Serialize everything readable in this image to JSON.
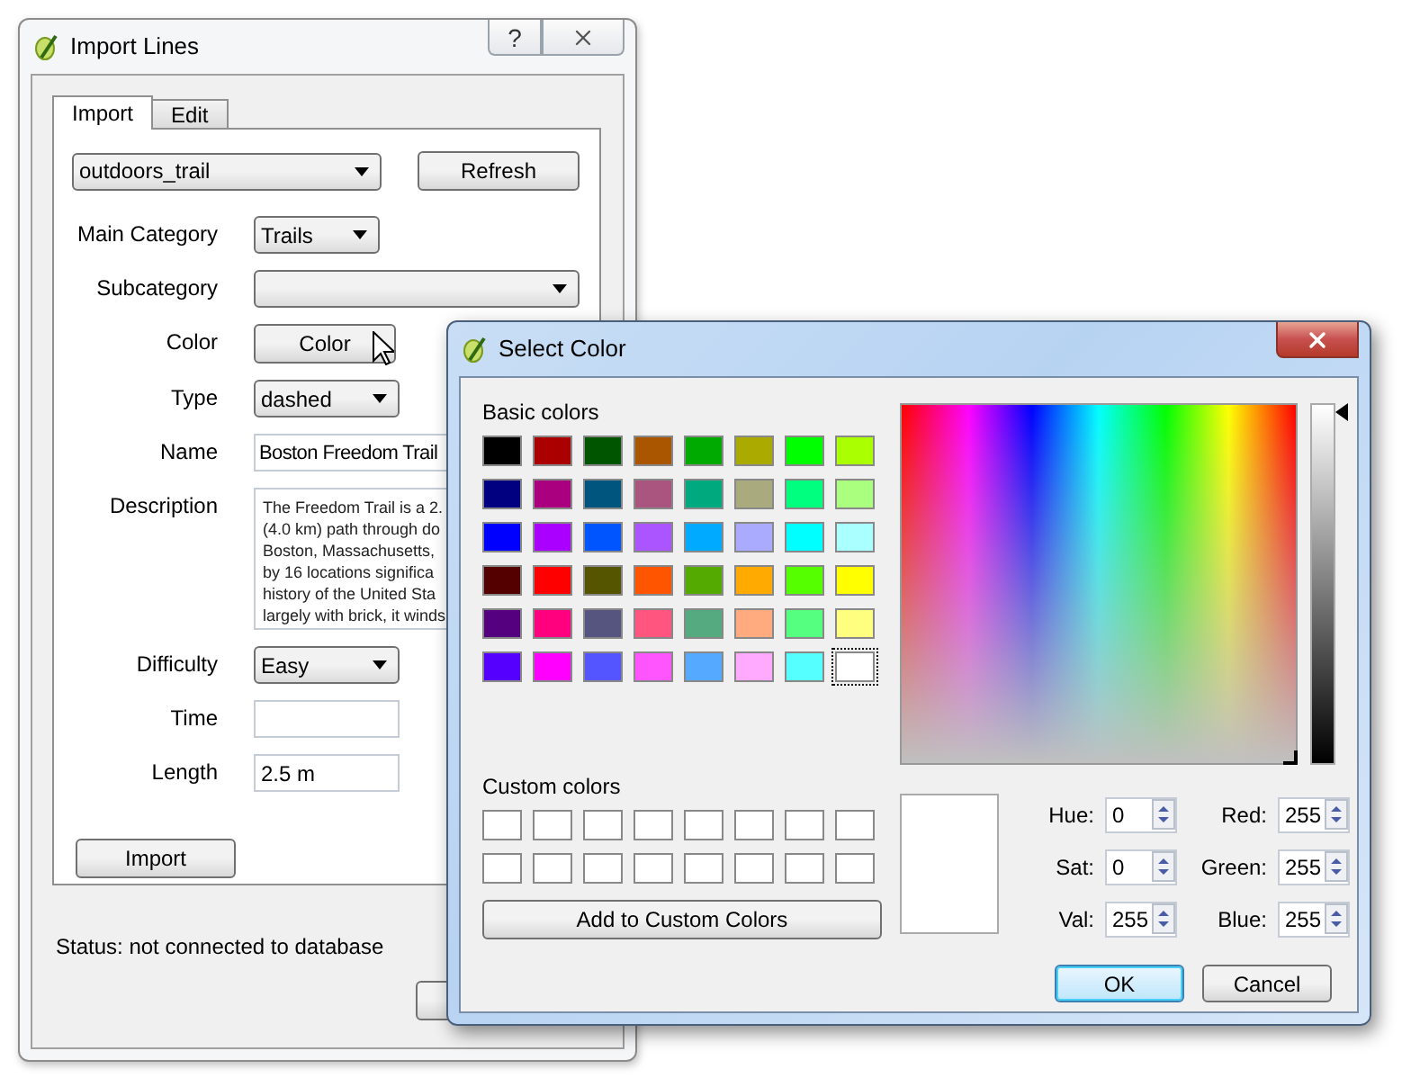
{
  "import_window": {
    "title": "Import Lines",
    "help_button": "?",
    "tabs": [
      {
        "label": "Import",
        "selected": true
      },
      {
        "label": "Edit",
        "selected": false
      }
    ],
    "source": {
      "value": "outdoors_trail"
    },
    "refresh_button": "Refresh",
    "form": [
      {
        "label": "Main Category",
        "kind": "combo",
        "value": "Trails"
      },
      {
        "label": "Subcategory",
        "kind": "combo"
      },
      {
        "label": "Color",
        "kind": "button",
        "value": "Color"
      },
      {
        "label": "Type",
        "kind": "combo",
        "value": "dashed"
      },
      {
        "label": "Name",
        "kind": "text",
        "value": "Boston Freedom Trail"
      },
      {
        "label": "Description",
        "kind": "textarea",
        "lines": [
          "The Freedom Trail is a 2.",
          "(4.0 km) path through do",
          "Boston, Massachusetts,",
          "by 16 locations significa",
          "history of the United Sta",
          "largely with brick, it winds"
        ]
      },
      {
        "label": "Difficulty",
        "kind": "combo",
        "value": "Easy"
      },
      {
        "label": "Time",
        "kind": "text"
      },
      {
        "label": "Length",
        "kind": "text",
        "value": "2.5 m"
      }
    ],
    "import_button": "Import",
    "status": "Status: not connected to database"
  },
  "color_dialog": {
    "title": "Select Color",
    "basic_colors_label": "Basic colors",
    "basic_colors": [
      {
        "color": "#000000",
        "selected": false
      },
      {
        "color": "#aa0000",
        "selected": false
      },
      {
        "color": "#005500",
        "selected": false
      },
      {
        "color": "#aa5500",
        "selected": false
      },
      {
        "color": "#00aa00",
        "selected": false
      },
      {
        "color": "#aaaa00",
        "selected": false
      },
      {
        "color": "#00ff00",
        "selected": false
      },
      {
        "color": "#aaff00",
        "selected": false
      },
      {
        "color": "#000080",
        "selected": false
      },
      {
        "color": "#aa007f",
        "selected": false
      },
      {
        "color": "#00557f",
        "selected": false
      },
      {
        "color": "#aa557f",
        "selected": false
      },
      {
        "color": "#00aa7f",
        "selected": false
      },
      {
        "color": "#aaaa7f",
        "selected": false
      },
      {
        "color": "#00ff7f",
        "selected": false
      },
      {
        "color": "#aaff7f",
        "selected": false
      },
      {
        "color": "#0000ff",
        "selected": false
      },
      {
        "color": "#aa00ff",
        "selected": false
      },
      {
        "color": "#0055ff",
        "selected": false
      },
      {
        "color": "#aa55ff",
        "selected": false
      },
      {
        "color": "#00aaff",
        "selected": false
      },
      {
        "color": "#aaaaff",
        "selected": false
      },
      {
        "color": "#00ffff",
        "selected": false
      },
      {
        "color": "#aaffff",
        "selected": false
      },
      {
        "color": "#550000",
        "selected": false
      },
      {
        "color": "#ff0000",
        "selected": false
      },
      {
        "color": "#555500",
        "selected": false
      },
      {
        "color": "#ff5500",
        "selected": false
      },
      {
        "color": "#55aa00",
        "selected": false
      },
      {
        "color": "#ffaa00",
        "selected": false
      },
      {
        "color": "#55ff00",
        "selected": false
      },
      {
        "color": "#ffff00",
        "selected": false
      },
      {
        "color": "#55007f",
        "selected": false
      },
      {
        "color": "#ff007f",
        "selected": false
      },
      {
        "color": "#55557f",
        "selected": false
      },
      {
        "color": "#ff557f",
        "selected": false
      },
      {
        "color": "#55aa7f",
        "selected": false
      },
      {
        "color": "#ffaa7f",
        "selected": false
      },
      {
        "color": "#55ff7f",
        "selected": false
      },
      {
        "color": "#ffff7f",
        "selected": false
      },
      {
        "color": "#5500ff",
        "selected": false
      },
      {
        "color": "#ff00ff",
        "selected": false
      },
      {
        "color": "#5555ff",
        "selected": false
      },
      {
        "color": "#ff55ff",
        "selected": false
      },
      {
        "color": "#55aaff",
        "selected": false
      },
      {
        "color": "#ffaaff",
        "selected": false
      },
      {
        "color": "#55ffff",
        "selected": false
      },
      {
        "color": "#ffffff",
        "selected": true
      }
    ],
    "value_slider": {
      "level": 1
    },
    "custom_colors_label": "Custom colors",
    "add_button": "Add to Custom Colors",
    "spin_fields": [
      {
        "label": "Hue:",
        "value": "0"
      },
      {
        "label": "Red:",
        "value": "255"
      },
      {
        "label": "Sat:",
        "value": "0"
      },
      {
        "label": "Green:",
        "value": "255"
      },
      {
        "label": "Val:",
        "value": "255"
      },
      {
        "label": "Blue:",
        "value": "255"
      }
    ],
    "buttons": [
      {
        "label": "OK",
        "default": true
      },
      {
        "label": "Cancel",
        "default": false
      }
    ]
  }
}
